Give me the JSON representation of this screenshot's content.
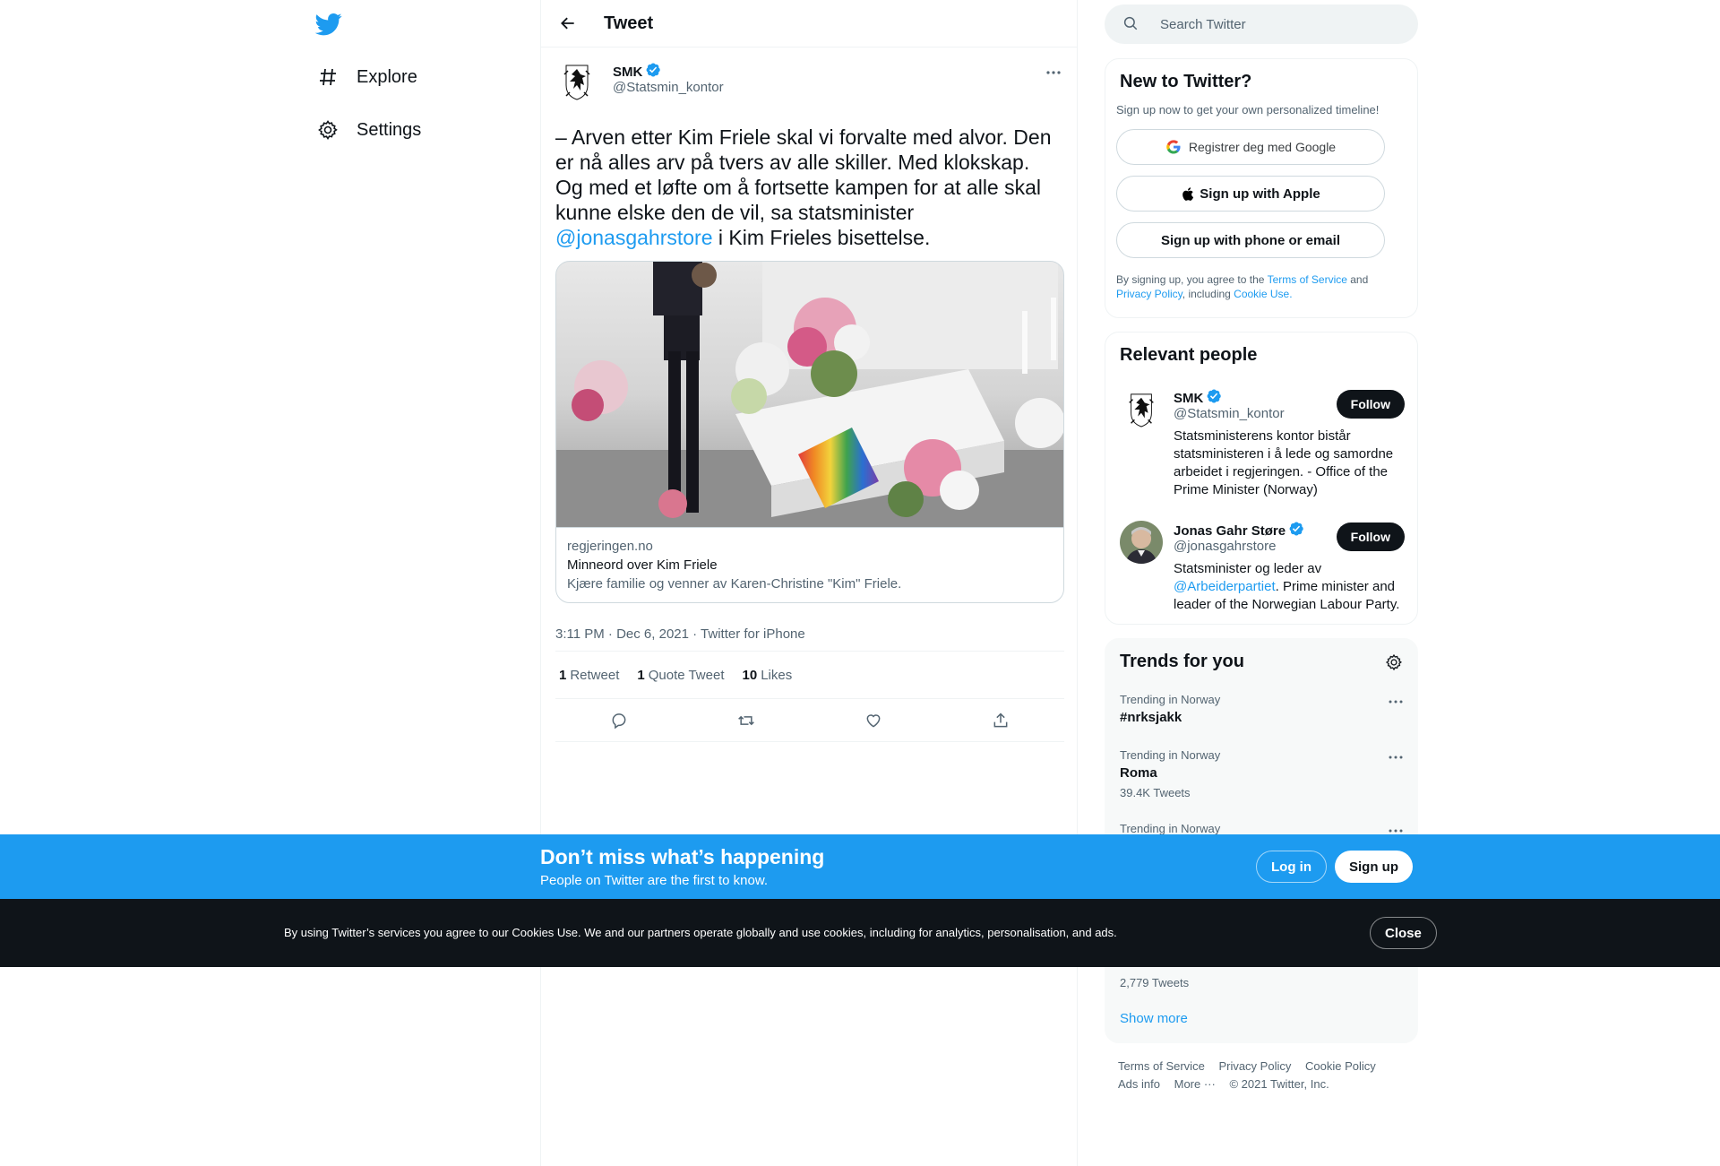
{
  "nav": {
    "items": [
      {
        "label": "Explore",
        "icon": "hashtag-icon"
      },
      {
        "label": "Settings",
        "icon": "gear-icon"
      }
    ]
  },
  "header": {
    "title": "Tweet"
  },
  "tweet": {
    "author_name": "SMK",
    "author_handle": "@Statsmin_kontor",
    "text_before": "– Arven etter Kim Friele skal vi forvalte med alvor. Den er nå alles arv på tvers av alle skiller. Med klokskap. Og med et løfte om å fortsette kampen for at alle skal kunne elske den de vil, sa statsminister ",
    "mention": "@jonasgahrstore",
    "text_after": " i Kim Frieles bisettelse.",
    "card": {
      "domain": "regjeringen.no",
      "title": "Minneord over Kim Friele",
      "description": "Kjære familie og venner av Karen-Christine \"Kim\" Friele."
    },
    "meta": "3:11 PM · Dec 6, 2021 · Twitter for iPhone",
    "stats": {
      "retweets_count": "1",
      "retweets_label": "Retweet",
      "quotes_count": "1",
      "quotes_label": "Quote Tweet",
      "likes_count": "10",
      "likes_label": "Likes"
    }
  },
  "search": {
    "placeholder": "Search Twitter"
  },
  "signup": {
    "title": "New to Twitter?",
    "subtitle": "Sign up now to get your own personalized timeline!",
    "google_label": "Registrer deg med Google",
    "apple_label": "Sign up with Apple",
    "phone_label": "Sign up with phone or email",
    "legal_1": "By signing up, you agree to the ",
    "terms": "Terms of Service",
    "legal_2": " and ",
    "privacy": "Privacy Policy",
    "legal_3": ", including ",
    "cookie": "Cookie Use."
  },
  "people": {
    "title": "Relevant people",
    "list": [
      {
        "name": "SMK",
        "handle": "@Statsmin_kontor",
        "bio": "Statsministerens kontor bistår statsministeren i å lede og samordne arbeidet i regjeringen. - Office of the Prime Minister (Norway)",
        "follow_label": "Follow"
      },
      {
        "name": "Jonas Gahr Støre",
        "handle": "@jonasgahrstore",
        "bio_before": "Statsminister og leder av ",
        "bio_mention": "@Arbeiderpartiet",
        "bio_after": ". Prime minister and leader of the Norwegian Labour Party.",
        "follow_label": "Follow"
      }
    ]
  },
  "trends": {
    "title": "Trends for you",
    "items": [
      {
        "context": "Trending in Norway",
        "name": "#nrksjakk",
        "count": ""
      },
      {
        "context": "Trending in Norway",
        "name": "Roma",
        "count": "39.4K Tweets"
      },
      {
        "context": "Trending in Norway",
        "name": "",
        "count": ""
      }
    ],
    "hidden_count": "2,779 Tweets",
    "show_more": "Show more"
  },
  "footer": {
    "links": [
      "Terms of Service",
      "Privacy Policy",
      "Cookie Policy",
      "Ads info",
      "More ···"
    ],
    "copyright": "© 2021 Twitter, Inc."
  },
  "banner": {
    "title": "Don’t miss what’s happening",
    "subtitle": "People on Twitter are the first to know.",
    "login": "Log in",
    "signup": "Sign up"
  },
  "cookies": {
    "text": "By using Twitter’s services you agree to our Cookies Use. We and our partners operate globally and use cookies, including for analytics, personalisation, and ads.",
    "close": "Close"
  },
  "colors": {
    "accent": "#1d9bf0",
    "text": "#0f1419",
    "muted": "#536471",
    "dark": "#0f1419"
  }
}
